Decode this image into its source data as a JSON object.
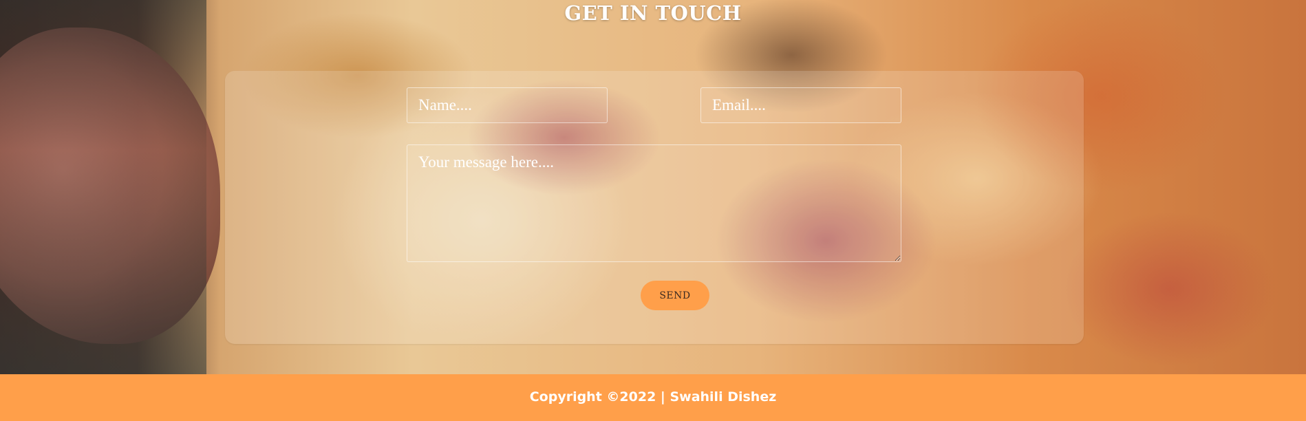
{
  "contact": {
    "title": "GET IN TOUCH",
    "name_placeholder": "Name....",
    "email_placeholder": "Email....",
    "message_placeholder": "Your message here....",
    "send_label": "SEND"
  },
  "footer": {
    "copyright": "Copyright ©2022 | Swahili Dishez"
  },
  "colors": {
    "accent": "#ff9f4a",
    "footer_text": "#ffffff",
    "panel_overlay": "rgba(255,255,255,0.16)"
  }
}
